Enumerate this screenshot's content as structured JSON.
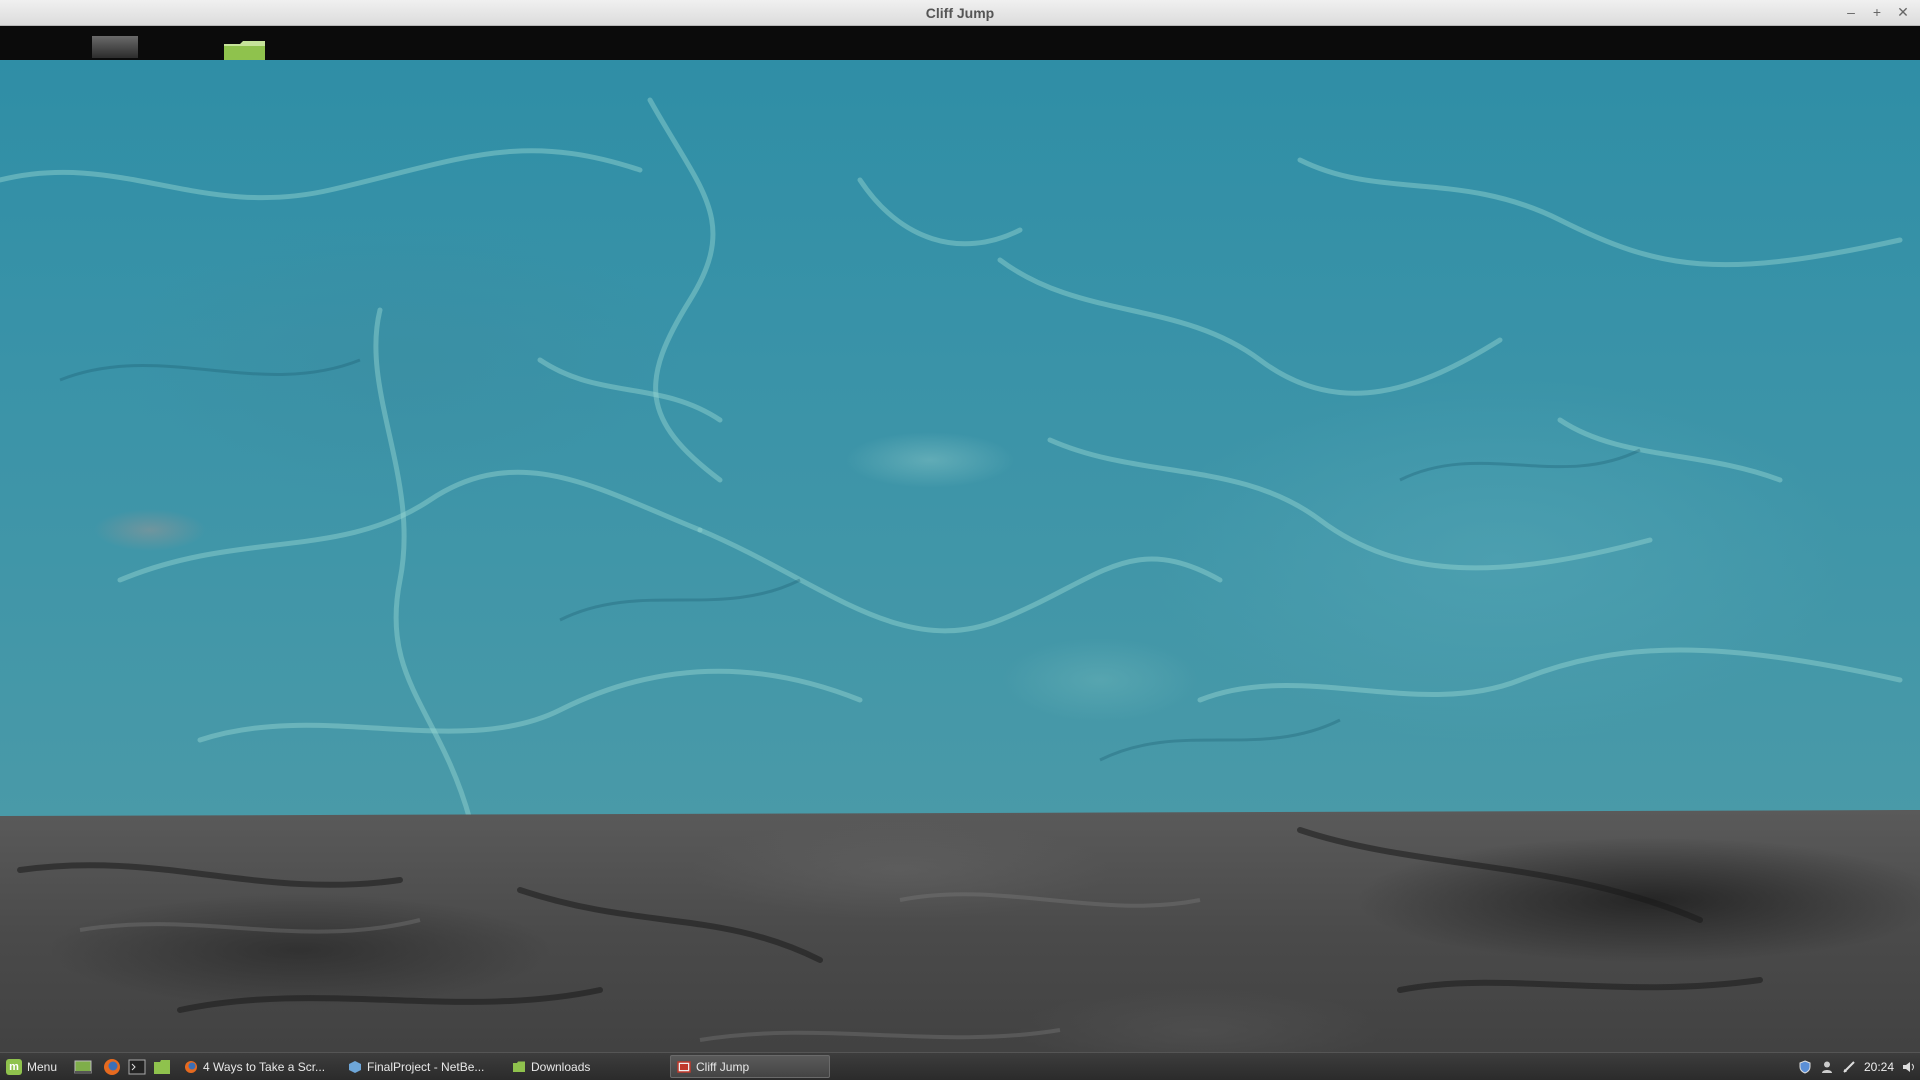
{
  "window": {
    "title": "Cliff Jump",
    "controls": {
      "minimize": "–",
      "maximize": "+",
      "close": "✕"
    }
  },
  "game": {
    "hud_icons": [
      "gray-block-icon",
      "folder-icon"
    ],
    "scene": [
      "water",
      "rock-ledge"
    ]
  },
  "taskbar": {
    "menu_label": "Menu",
    "launchers": [
      "show-desktop-icon",
      "firefox-icon",
      "terminal-icon",
      "files-icon"
    ],
    "tasks": [
      {
        "label": "4 Ways to Take a Scr...",
        "icon": "firefox-icon",
        "active": false
      },
      {
        "label": "FinalProject - NetBe...",
        "icon": "netbeans-icon",
        "active": false
      },
      {
        "label": "Downloads",
        "icon": "folder-icon",
        "active": false
      },
      {
        "label": "Cliff Jump",
        "icon": "java-app-icon",
        "active": true
      }
    ],
    "tray": {
      "icons": [
        "shield-icon",
        "user-icon",
        "network-icon",
        "volume-icon"
      ],
      "clock": "20:24"
    }
  },
  "colors": {
    "water": "#3a93a8",
    "rock": "#4a4a4a",
    "hud": "#0b0b0b",
    "folder": "#8fc24d"
  }
}
